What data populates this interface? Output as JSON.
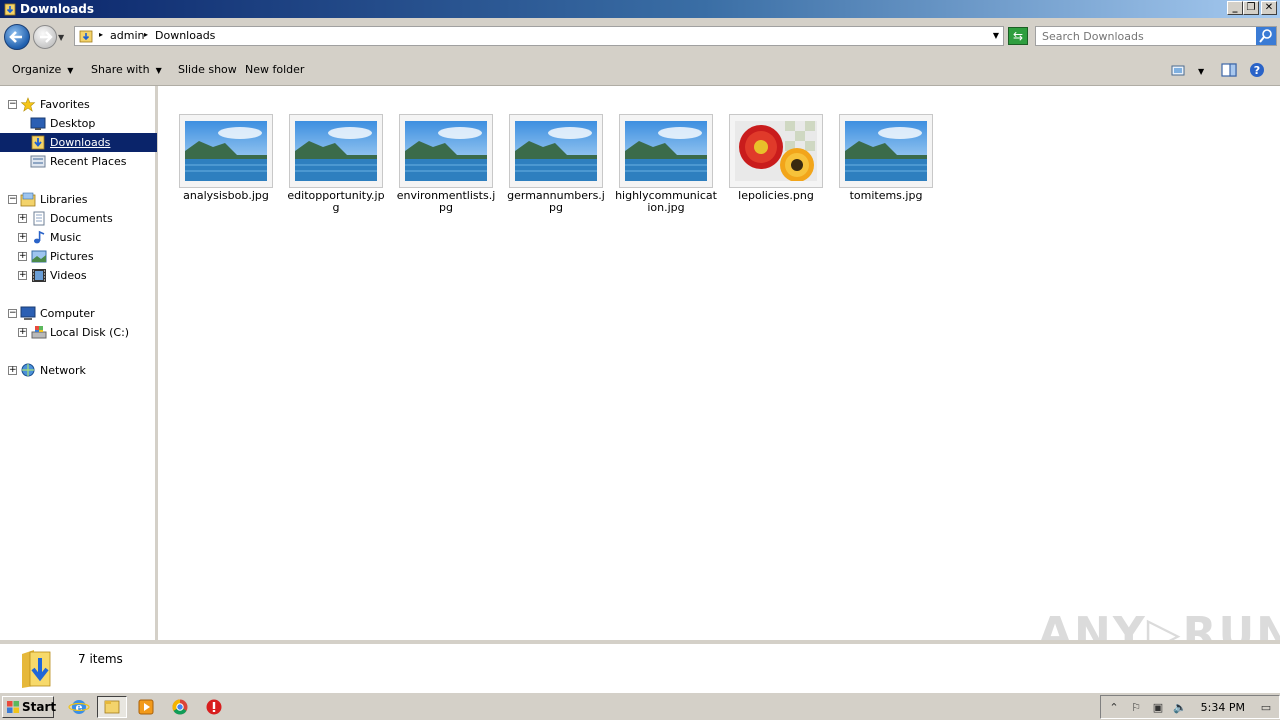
{
  "window": {
    "title": "Downloads",
    "buttons": {
      "minimize": "_",
      "maximize": "❐",
      "close": "✕"
    }
  },
  "address": {
    "crumbs": [
      "admin",
      "Downloads"
    ],
    "search_placeholder": "Search Downloads"
  },
  "toolbar": {
    "organize": "Organize",
    "share_with": "Share with",
    "slide_show": "Slide show",
    "new_folder": "New folder"
  },
  "nav": {
    "favorites": "Favorites",
    "desktop": "Desktop",
    "downloads": "Downloads",
    "recent_places": "Recent Places",
    "libraries": "Libraries",
    "documents": "Documents",
    "music": "Music",
    "pictures": "Pictures",
    "videos": "Videos",
    "computer": "Computer",
    "local_disk": "Local Disk (C:)",
    "network": "Network"
  },
  "files": [
    {
      "name": "analysisbob.jpg",
      "kind": "landscape"
    },
    {
      "name": "editopportunity.jpg",
      "kind": "landscape"
    },
    {
      "name": "environmentlists.jpg",
      "kind": "landscape"
    },
    {
      "name": "germannumbers.jpg",
      "kind": "landscape"
    },
    {
      "name": "highlycommunication.jpg",
      "kind": "landscape"
    },
    {
      "name": "lepolicies.png",
      "kind": "flowers"
    },
    {
      "name": "tomitems.jpg",
      "kind": "landscape"
    }
  ],
  "details": {
    "count": "7 items"
  },
  "watermark": "ANY▷RUN",
  "taskbar": {
    "start": "Start",
    "clock": "5:34 PM"
  }
}
